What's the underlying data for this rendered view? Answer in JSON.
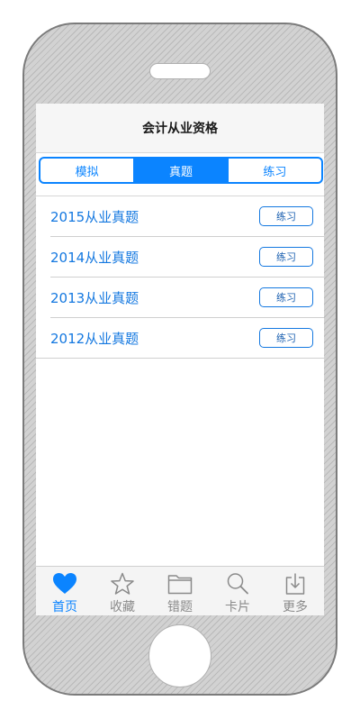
{
  "header": {
    "title": "会计从业资格"
  },
  "segments": [
    {
      "label": "模拟"
    },
    {
      "label": "真题"
    },
    {
      "label": "练习"
    }
  ],
  "selected_segment": "真题",
  "list": [
    {
      "title": "2015从业真题",
      "action": "练习"
    },
    {
      "title": "2014从业真题",
      "action": "练习"
    },
    {
      "title": "2013从业真题",
      "action": "练习"
    },
    {
      "title": "2012从业真题",
      "action": "练习"
    }
  ],
  "tabbar": [
    {
      "label": "首页",
      "icon": "heart-icon"
    },
    {
      "label": "收藏",
      "icon": "star-icon"
    },
    {
      "label": "错题",
      "icon": "folder-icon"
    },
    {
      "label": "卡片",
      "icon": "search-icon"
    },
    {
      "label": "更多",
      "icon": "download-icon"
    }
  ],
  "active_tab": "首页",
  "colors": {
    "accent": "#0b84ff",
    "link": "#1478e0",
    "inactive": "#8a8a8a"
  }
}
